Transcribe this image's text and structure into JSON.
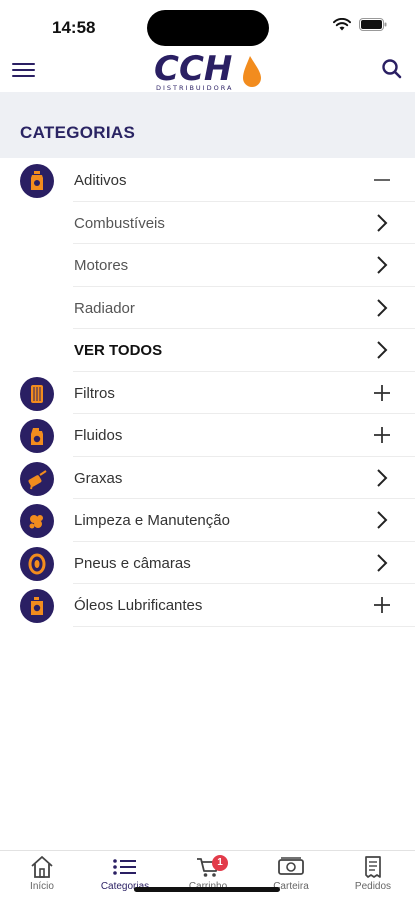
{
  "status_bar": {
    "time": "14:58"
  },
  "header": {
    "logo_text": "CCH",
    "logo_subtext": "DISTRIBUIDORA"
  },
  "section": {
    "title": "CATEGORIAS"
  },
  "categories": [
    {
      "label": "Aditivos",
      "icon": "additive-bottle-icon",
      "action": "minus"
    },
    {
      "label": "Combustíveis",
      "action": "chevron",
      "sub": true
    },
    {
      "label": "Motores",
      "action": "chevron",
      "sub": true
    },
    {
      "label": "Radiador",
      "action": "chevron",
      "sub": true
    },
    {
      "label": "VER TODOS",
      "action": "chevron",
      "sub": true,
      "bold": true
    },
    {
      "label": "Filtros",
      "icon": "filter-icon",
      "action": "plus"
    },
    {
      "label": "Fluidos",
      "icon": "fluid-can-icon",
      "action": "plus"
    },
    {
      "label": "Graxas",
      "icon": "grease-gun-icon",
      "action": "chevron"
    },
    {
      "label": "Limpeza e Manutenção",
      "icon": "cleaning-icon",
      "action": "chevron"
    },
    {
      "label": "Pneus e câmaras",
      "icon": "tire-icon",
      "action": "chevron"
    },
    {
      "label": "Óleos Lubrificantes",
      "icon": "oil-can-icon",
      "action": "plus"
    }
  ],
  "tabbar": {
    "tabs": [
      {
        "label": "Início",
        "icon": "home-icon"
      },
      {
        "label": "Categorias",
        "icon": "list-icon",
        "active": true
      },
      {
        "label": "Carrinho",
        "icon": "cart-icon"
      },
      {
        "label": "Carteira",
        "icon": "wallet-icon"
      },
      {
        "label": "Pedidos",
        "icon": "receipt-icon"
      }
    ],
    "cart_badge": "1"
  },
  "colors": {
    "brand_navy": "#2a1f63",
    "brand_orange": "#f28c1e",
    "badge_red": "#e23b4a",
    "section_bg": "#eef0f4"
  }
}
